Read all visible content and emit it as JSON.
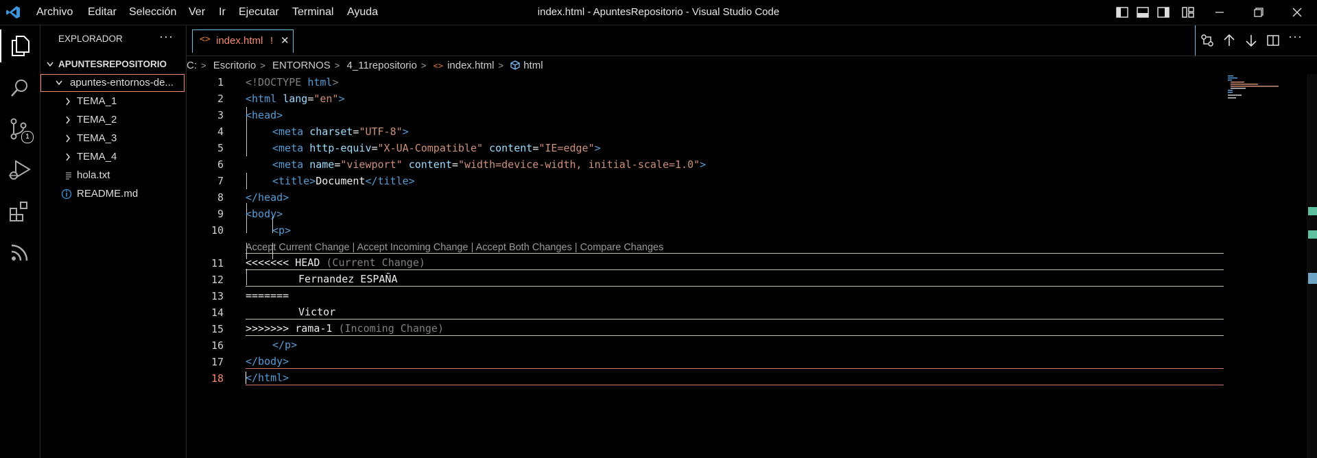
{
  "titlebar": {
    "menu": [
      "Archivo",
      "Editar",
      "Selección",
      "Ver",
      "Ir",
      "Ejecutar",
      "Terminal",
      "Ayuda"
    ],
    "title": "index.html - ApuntesRepositorio - Visual Studio Code"
  },
  "activity": {
    "scm_badge": "1"
  },
  "sidebar": {
    "header": "EXPLORADOR",
    "more": "···",
    "root": "APUNTESREPOSITORIO",
    "folder": "apuntes-entornos-de...",
    "items": [
      {
        "label": "TEMA_1",
        "type": "folder"
      },
      {
        "label": "TEMA_2",
        "type": "folder"
      },
      {
        "label": "TEMA_3",
        "type": "folder"
      },
      {
        "label": "TEMA_4",
        "type": "folder"
      },
      {
        "label": "hola.txt",
        "type": "file"
      },
      {
        "label": "README.md",
        "type": "info"
      }
    ]
  },
  "tab": {
    "label": "index.html",
    "badge": "!",
    "close": "✕"
  },
  "breadcrumb": [
    "C:",
    "Escritorio",
    "ENTORNOS",
    "4_11repositorio",
    "index.html",
    "html"
  ],
  "codelens": "Accept Current Change | Accept Incoming Change | Accept Both Changes | Compare Changes",
  "code": {
    "l1": {
      "n": "1",
      "a": "<!DOCTYPE ",
      "b": "html",
      "c": ">"
    },
    "l2": {
      "n": "2",
      "a": "<html ",
      "b": "lang",
      "c": "=",
      "d": "\"en\"",
      "e": ">"
    },
    "l3": {
      "n": "3",
      "a": "<head>"
    },
    "l4": {
      "n": "4",
      "a": "<meta ",
      "b": "charset",
      "c": "=",
      "d": "\"UTF-8\"",
      "e": ">"
    },
    "l5": {
      "n": "5",
      "a": "<meta ",
      "b": "http-equiv",
      "c": "=",
      "d": "\"X-UA-Compatible\"",
      "e": " ",
      "f": "content",
      "g": "=",
      "h": "\"IE=edge\"",
      "i": ">"
    },
    "l6": {
      "n": "6",
      "a": "<meta ",
      "b": "name",
      "c": "=",
      "d": "\"viewport\"",
      "e": " ",
      "f": "content",
      "g": "=",
      "h": "\"width=device-width, initial-scale=1.0\"",
      "i": ">"
    },
    "l7": {
      "n": "7",
      "a": "<title>",
      "b": "Document",
      "c": "</title>"
    },
    "l8": {
      "n": "8",
      "a": "</head>"
    },
    "l9": {
      "n": "9",
      "a": "<body>"
    },
    "l10": {
      "n": "10",
      "a": "<p>"
    },
    "l11": {
      "n": "11",
      "a": "<<<<<<< HEAD ",
      "b": "(Current Change)"
    },
    "l12": {
      "n": "12",
      "a": "Fernandez ESPAÑA"
    },
    "l13": {
      "n": "13",
      "a": "======="
    },
    "l14": {
      "n": "14",
      "a": "Victor"
    },
    "l15": {
      "n": "15",
      "a": ">>>>>>> rama-1 ",
      "b": "(Incoming Change)"
    },
    "l16": {
      "n": "16",
      "a": "</p>"
    },
    "l17": {
      "n": "17",
      "a": "</body>"
    },
    "l18": {
      "n": "18",
      "a": "</html>"
    }
  },
  "colors": {
    "accent": "#3a96dd",
    "tag": "#569cd6",
    "attr": "#9cdcfe",
    "string": "#ce9178",
    "modified": "#f48771",
    "conflict_line": "#c8c8a8"
  }
}
